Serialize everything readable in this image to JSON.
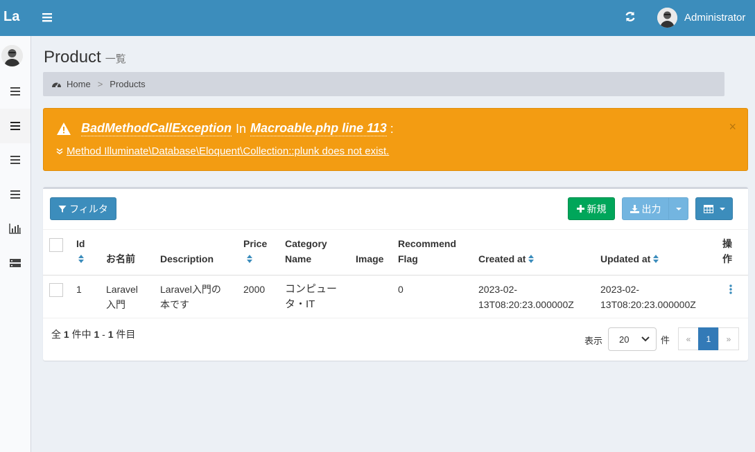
{
  "header": {
    "logo": "La",
    "user_name": "Administrator"
  },
  "page": {
    "title": "Product",
    "subtitle": "一覧"
  },
  "breadcrumb": {
    "home": "Home",
    "current": "Products"
  },
  "alert": {
    "exception": "BadMethodCallException",
    "in": "In",
    "location": "Macroable.php line 113",
    "colon": ":",
    "message": "Method Illuminate\\Database\\Eloquent\\Collection::plunk does not exist.",
    "close": "×"
  },
  "toolbar": {
    "filter_label": "フィルタ",
    "new_label": "新規",
    "export_label": "出力"
  },
  "table": {
    "headers": {
      "id": "Id",
      "name": "お名前",
      "description": "Description",
      "price": "Price",
      "category_1": "Category",
      "category_2": "Name",
      "image": "Image",
      "recommend_1": "Recommend",
      "recommend_2": "Flag",
      "created_at": "Created at",
      "updated_at": "Updated at",
      "actions_1": "操",
      "actions_2": "作"
    },
    "rows": [
      {
        "id": "1",
        "name_1": "Laravel",
        "name_2": "入門",
        "desc_1": "Laravel入門の",
        "desc_2": "本です",
        "price": "2000",
        "category_1": "コンピュー",
        "category_2": "タ・IT",
        "recommend_flag": "0",
        "created_1": "2023-02-",
        "created_2": "13T08:20:23.000000Z",
        "updated_1": "2023-02-",
        "updated_2": "13T08:20:23.000000Z"
      }
    ]
  },
  "footer": {
    "prefix": "全",
    "total": "1",
    "mid": "件中",
    "from": "1",
    "dash": "-",
    "to": "1",
    "suffix": "件目",
    "per_page_label": "表示",
    "per_page_value": "20",
    "per_page_unit": "件"
  },
  "pagination": {
    "prev": "«",
    "current": "1",
    "next": "»"
  },
  "colors": {
    "header": "#3c8dbc",
    "alert": "#f39c12",
    "success": "#00a65a",
    "primary": "#3c8dbc"
  }
}
